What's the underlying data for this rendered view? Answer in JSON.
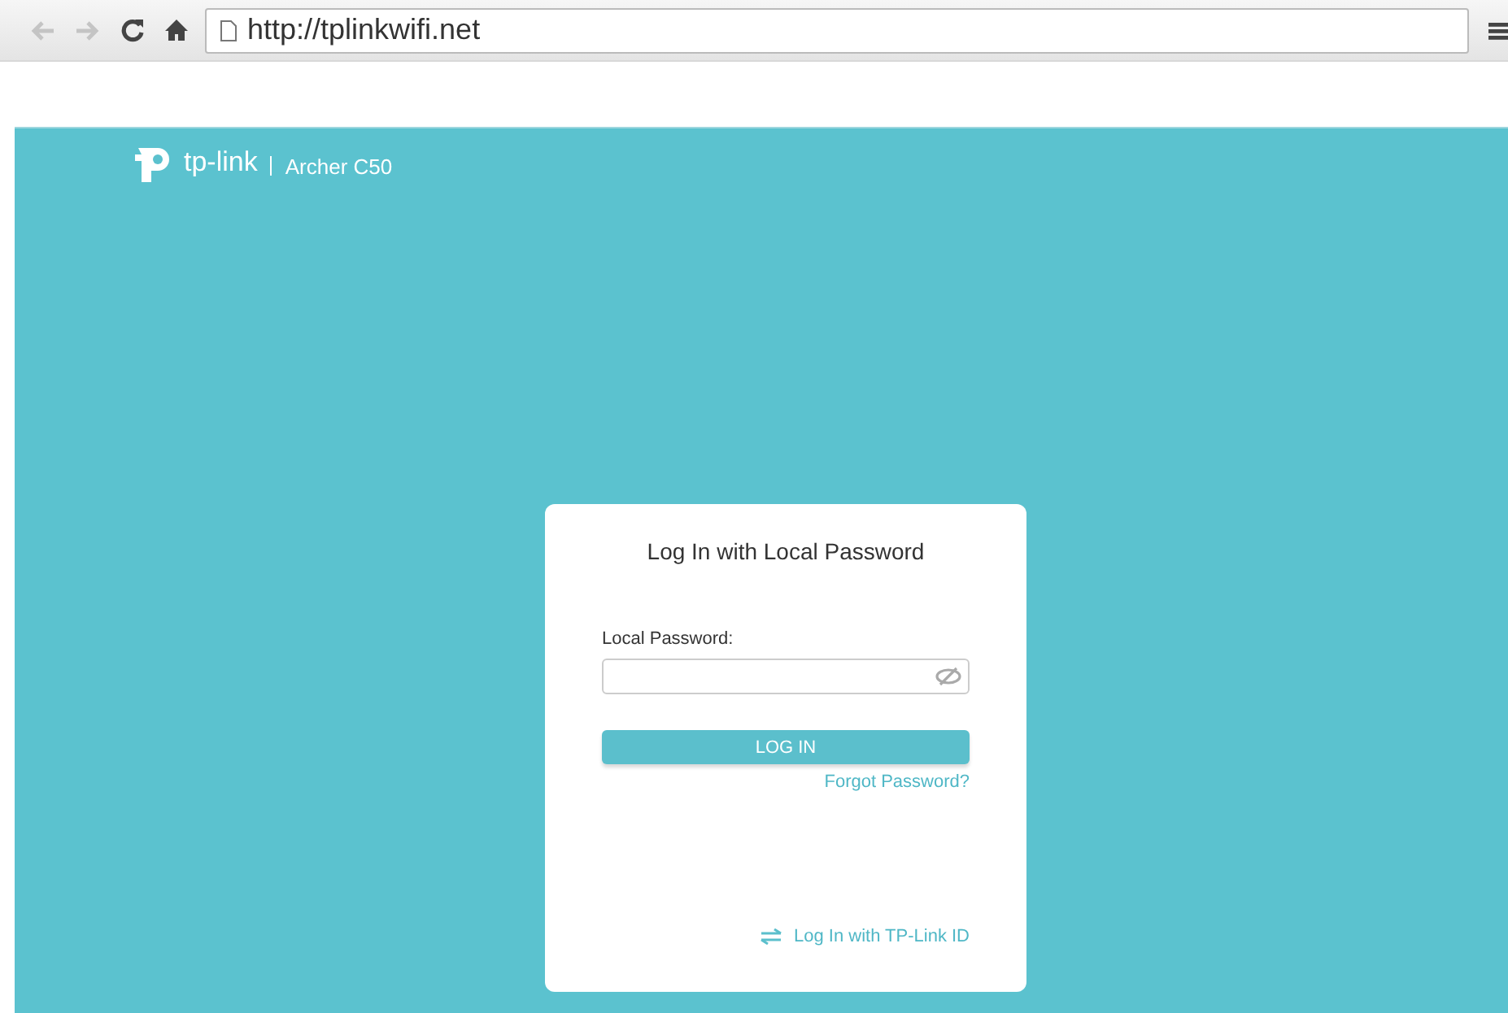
{
  "browser": {
    "url": "http://tplinkwifi.net"
  },
  "header": {
    "brand": "tp-link",
    "model": "Archer C50"
  },
  "login": {
    "title": "Log In with Local Password",
    "field_label": "Local Password:",
    "button": "LOG IN",
    "forgot_link": "Forgot Password?",
    "alt_login_link": "Log In with TP-Link ID"
  }
}
